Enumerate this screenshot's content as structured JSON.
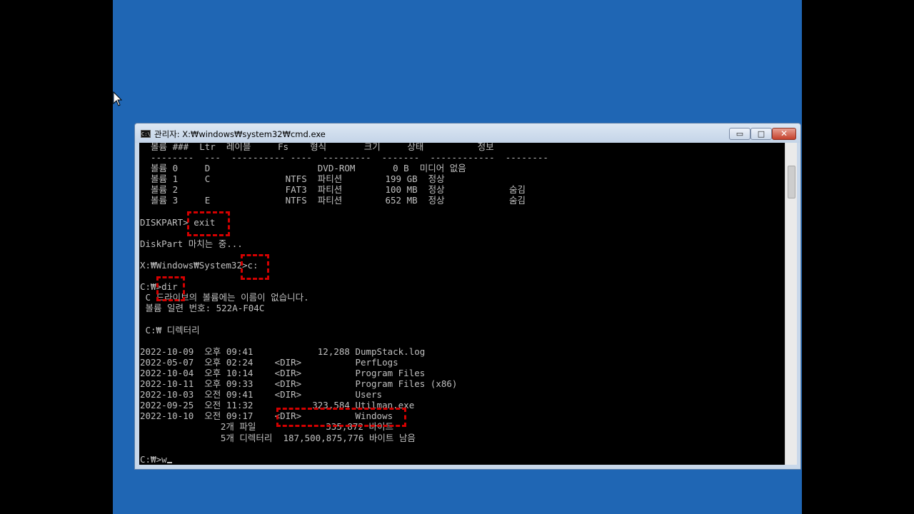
{
  "window": {
    "title": "관리자: X:₩windows₩system32₩cmd.exe",
    "icon_text": "C:\\",
    "buttons": {
      "minimize": "▭",
      "maximize": "□",
      "close": "✕"
    }
  },
  "console": {
    "lines": [
      "  볼륨 ###  Ltr  레이블     Fs    형식       크기     상태          정보",
      "  --------  ---  ---------- ----  ---------  -------  ------------  --------",
      "  볼륨 0     D                    DVD-ROM       0 B  미디어 없음",
      "  볼륨 1     C              NTFS  파티션        199 GB  정상",
      "  볼륨 2                    FAT3  파티션        100 MB  정상            숨김",
      "  볼륨 3     E              NTFS  파티션        652 MB  정상            숨김",
      "",
      "DISKPART> exit",
      "",
      "DiskPart 마치는 중...",
      "",
      "X:₩Windows₩System32>c:",
      "",
      "C:₩>dir",
      " C 드라이브의 볼륨에는 이름이 없습니다.",
      " 볼륨 일련 번호: 522A-F04C",
      "",
      " C:₩ 디렉터리",
      "",
      "2022-10-09  오후 09:41            12,288 DumpStack.log",
      "2022-05-07  오후 02:24    <DIR>          PerfLogs",
      "2022-10-04  오후 10:14    <DIR>          Program Files",
      "2022-10-11  오후 09:33    <DIR>          Program Files (x86)",
      "2022-10-03  오전 09:41    <DIR>          Users",
      "2022-09-25  오전 11:32           323,584 Utilman.exe",
      "2022-10-10  오전 09:17    <DIR>          Windows",
      "               2개 파일             335,872 바이트",
      "               5개 디렉터리  187,500,875,776 바이트 남음",
      "",
      "C:₩>w"
    ]
  },
  "colors": {
    "desktop": "#1f66b4",
    "console_bg": "#000000",
    "console_fg": "#c0c0c0",
    "highlight": "#d40000"
  }
}
